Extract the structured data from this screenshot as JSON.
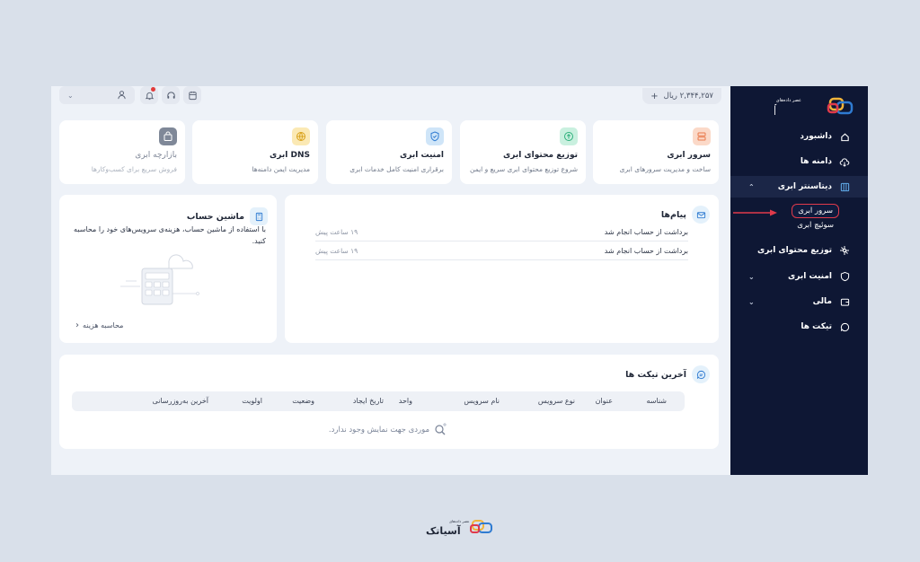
{
  "brand": {
    "name": "آسیاتک",
    "tagline": "عصر داده‌های"
  },
  "colors": {
    "sidebar_bg": "#0e1734",
    "highlight": "#e03a4b",
    "accent": "#2f7bd1"
  },
  "sidebar": {
    "items": [
      {
        "label": "داشبورد",
        "icon": "home-icon"
      },
      {
        "label": "دامنه ها",
        "icon": "cloud-download-icon"
      },
      {
        "label": "دیتاسنتر ابری",
        "icon": "datacenter-icon",
        "expanded": true
      },
      {
        "label": "توزیع محتوای ابری",
        "icon": "network-icon"
      },
      {
        "label": "امنیت ابری",
        "icon": "shield-icon"
      },
      {
        "label": "مالی",
        "icon": "wallet-icon"
      },
      {
        "label": "تیکت ها",
        "icon": "chat-icon"
      }
    ],
    "sub_items": [
      "سرور ابری",
      "سوئیچ ابری"
    ]
  },
  "topbar": {
    "balance": "۲,۳۴۴,۲۵۷ ریال",
    "add_symbol": "+"
  },
  "cards": [
    {
      "title": "سرور ابری",
      "desc": "ساخت و مدیریت سرورهای ابری",
      "icon": "server-icon",
      "color": "#f6a27c"
    },
    {
      "title": "توزیع محتوای ابری",
      "desc": "شروع توزیع محتوای ابری سریع و ایمن",
      "icon": "cloud-upload-icon",
      "color": "#6fd4a7"
    },
    {
      "title": "امنیت ابری",
      "desc": "برقراری امنیت کامل خدمات ابری",
      "icon": "shield-check-icon",
      "color": "#5fa8e6"
    },
    {
      "title": "DNS ابری",
      "desc": "مدیریت ایمن دامنه‌ها",
      "icon": "globe-icon",
      "color": "#f4c64a"
    },
    {
      "title": "بازارچه ابری",
      "desc": "فروش سریع برای کسب‌وکارها",
      "icon": "shopping-bag-icon",
      "color": "#7f8898"
    }
  ],
  "messages": {
    "title": "پیام‌ها",
    "rows": [
      {
        "text": "برداشت از حساب انجام شد",
        "time": "۱۹ ساعت پیش"
      },
      {
        "text": "برداشت از حساب انجام شد",
        "time": "۱۹ ساعت پیش"
      }
    ]
  },
  "calculator": {
    "title": "ماشین حساب",
    "text": "با استفاده از ماشین حساب، هزینه‌ی سرویس‌های خود را محاسبه کنید.",
    "link": "محاسبه هزینه"
  },
  "tickets": {
    "title": "آخرین تیکت ها",
    "columns": [
      "شناسه",
      "عنوان",
      "نوع سرویس",
      "نام سرویس",
      "واحد",
      "تاریخ ایجاد",
      "وضعیت",
      "اولویت",
      "آخرین به‌روزرسانی"
    ],
    "empty": "موردی جهت نمایش وجود ندارد."
  }
}
